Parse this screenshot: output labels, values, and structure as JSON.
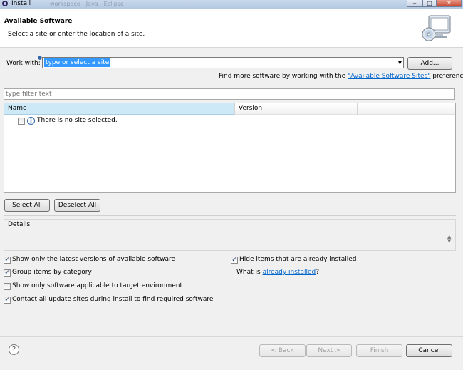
{
  "window": {
    "title": "Install",
    "ghost_title": "workspace - Java - Eclipse"
  },
  "banner": {
    "title": "Available Software",
    "subtitle": "Select a site or enter the location of a site."
  },
  "work_with": {
    "label": "Work with:",
    "value": "type or select a site",
    "add_label": "Add..."
  },
  "more_software": {
    "prefix": "Find more software by working with the ",
    "link": "\"Available Software Sites\"",
    "suffix": " preferences."
  },
  "filter": {
    "placeholder": "type filter text"
  },
  "table": {
    "columns": [
      "Name",
      "Version"
    ],
    "rows": [
      {
        "label": "There is no site selected."
      }
    ]
  },
  "buttons": {
    "select_all": "Select All",
    "deselect_all": "Deselect All",
    "back": "< Back",
    "next": "Next >",
    "finish": "Finish",
    "cancel": "Cancel"
  },
  "details": {
    "label": "Details"
  },
  "options": {
    "latest_versions": {
      "label": "Show only the latest versions of available software",
      "checked": true
    },
    "hide_installed": {
      "label": "Hide items that are already installed",
      "checked": true
    },
    "group_by_category": {
      "label": "Group items by category",
      "checked": true
    },
    "what_is_prefix": "What is ",
    "what_is_link": "already installed",
    "what_is_suffix": "?",
    "applicable_target": {
      "label": "Show only software applicable to target environment",
      "checked": false
    },
    "contact_sites": {
      "label": "Contact all update sites during install to find required software",
      "checked": true
    }
  },
  "icons": {
    "app": "eclipse-icon",
    "help": "help-icon",
    "info": "info-icon",
    "banner": "monitor-cd-icon"
  }
}
